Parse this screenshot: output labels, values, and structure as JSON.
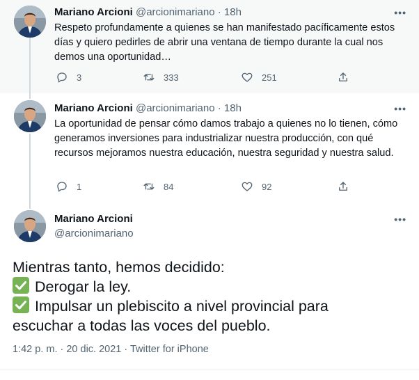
{
  "tweets": [
    {
      "name": "Mariano Arcioni",
      "handle": "@arcionimariano",
      "separator": "·",
      "time": "18h",
      "more": "•••",
      "text": "Respeto profundamente a quienes se han manifestado pacíficamente estos días y quiero pedirles de abrir una ventana de tiempo durante la cual nos demos una oportunidad…",
      "replies": "3",
      "retweets": "333",
      "likes": "251"
    },
    {
      "name": "Mariano Arcioni",
      "handle": "@arcionimariano",
      "separator": "·",
      "time": "18h",
      "more": "•••",
      "text": "La oportunidad de pensar cómo damos trabajo a quienes no lo tienen, cómo generamos inversiones para industrializar nuestra producción, con qué recursos mejoramos nuestra educación, nuestra seguridad y nuestra salud.",
      "replies": "1",
      "retweets": "84",
      "likes": "92"
    }
  ],
  "main_tweet": {
    "name": "Mariano Arcioni",
    "handle": "@arcionimariano",
    "more": "•••",
    "line1": "Mientras tanto, hemos decidido:",
    "line2": "Derogar la ley.",
    "line3": "Impulsar un plebiscito a nivel provincial para",
    "line4": "escuchar a todas las voces del pueblo.",
    "timestamp": "1:42 p. m. · 20 dic. 2021 · Twitter for iPhone"
  },
  "icons": {
    "reply": "reply-icon",
    "retweet": "retweet-icon",
    "like": "heart-icon",
    "share": "share-icon",
    "check": "check-mark-icon"
  },
  "colors": {
    "text": "#0f1419",
    "secondary": "#536471",
    "thread_line": "#cfd9de",
    "highlight_bg": "#f7f9f9",
    "check_green": "#77b255"
  }
}
